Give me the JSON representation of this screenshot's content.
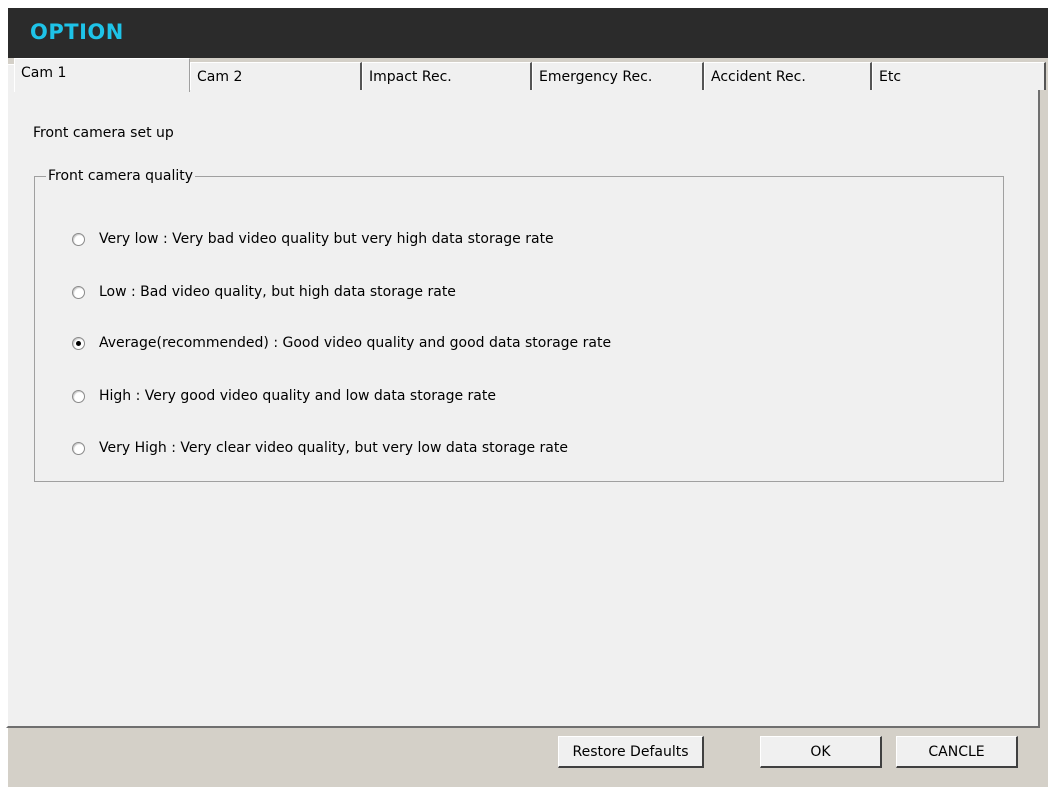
{
  "window": {
    "title": "OPTION"
  },
  "tabs": [
    {
      "label": "Cam 1",
      "active": true
    },
    {
      "label": "Cam 2",
      "active": false
    },
    {
      "label": "Impact Rec.",
      "active": false
    },
    {
      "label": "Emergency Rec.",
      "active": false
    },
    {
      "label": "Accident Rec.",
      "active": false
    },
    {
      "label": "Etc",
      "active": false
    }
  ],
  "content": {
    "subtitle": "Front camera set up",
    "group_label": "Front camera quality",
    "options": [
      {
        "label": "Very low : Very bad video quality but very high data storage rate",
        "checked": false
      },
      {
        "label": "Low : Bad video quality, but high data storage rate",
        "checked": false
      },
      {
        "label": "Average(recommended) : Good video quality and good data storage rate",
        "checked": true
      },
      {
        "label": "High : Very good video quality and low data storage rate",
        "checked": false
      },
      {
        "label": "Very High : Very clear video quality, but very low data storage rate",
        "checked": false
      }
    ]
  },
  "buttons": {
    "restore": "Restore Defaults",
    "ok": "OK",
    "cancel": "CANCLE"
  },
  "colors": {
    "title": "#1ec3e8",
    "titlebar": "#2b2b2b",
    "panel": "#f0f0f0",
    "frame": "#d4d0c8"
  }
}
